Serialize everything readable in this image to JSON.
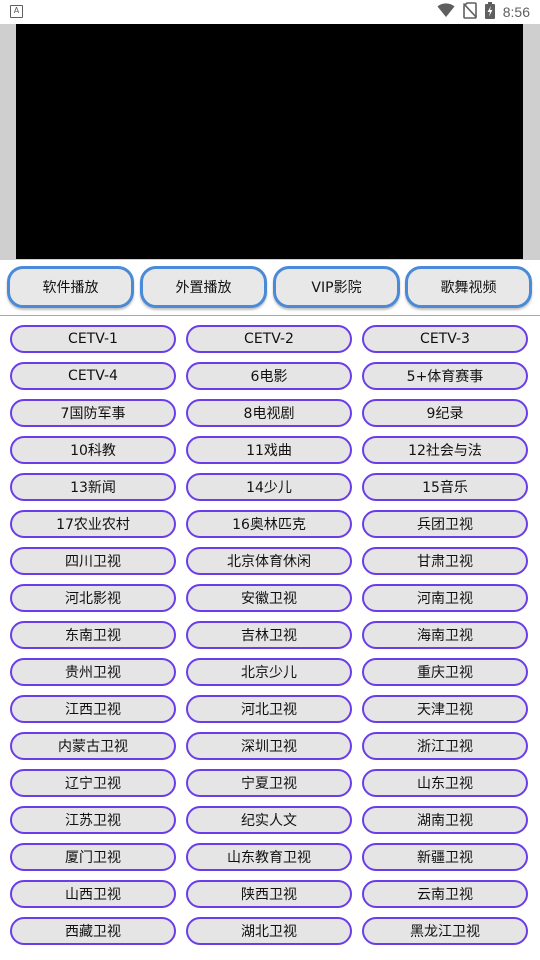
{
  "status_bar": {
    "notification_icon": "a-letter-icon",
    "time": "8:56",
    "icons": [
      "wifi-icon",
      "no-sim-icon",
      "battery-charging-icon"
    ]
  },
  "player": {
    "surface_color": "#000000"
  },
  "mode_buttons": [
    {
      "label": "软件播放"
    },
    {
      "label": "外置播放"
    },
    {
      "label": "VIP影院"
    },
    {
      "label": "歌舞视频"
    }
  ],
  "channels": [
    "CETV-1",
    "CETV-2",
    "CETV-3",
    "CETV-4",
    "6电影",
    "5+体育赛事",
    "7国防军事",
    "8电视剧",
    "9纪录",
    "10科教",
    "11戏曲",
    "12社会与法",
    "13新闻",
    "14少儿",
    "15音乐",
    "17农业农村",
    "16奥林匹克",
    "兵团卫视",
    "四川卫视",
    "北京体育休闲",
    "甘肃卫视",
    "河北影视",
    "安徽卫视",
    "河南卫视",
    "东南卫视",
    "吉林卫视",
    "海南卫视",
    "贵州卫视",
    "北京少儿",
    "重庆卫视",
    "江西卫视",
    "河北卫视",
    "天津卫视",
    "内蒙古卫视",
    "深圳卫视",
    "浙江卫视",
    "辽宁卫视",
    "宁夏卫视",
    "山东卫视",
    "江苏卫视",
    "纪实人文",
    "湖南卫视",
    "厦门卫视",
    "山东教育卫视",
    "新疆卫视",
    "山西卫视",
    "陕西卫视",
    "云南卫视",
    "西藏卫视",
    "湖北卫视",
    "黑龙江卫视"
  ],
  "colors": {
    "mode_border": "#4a8ad8",
    "channel_border": "#6a3de8",
    "button_fill": "#e5e5e5"
  }
}
